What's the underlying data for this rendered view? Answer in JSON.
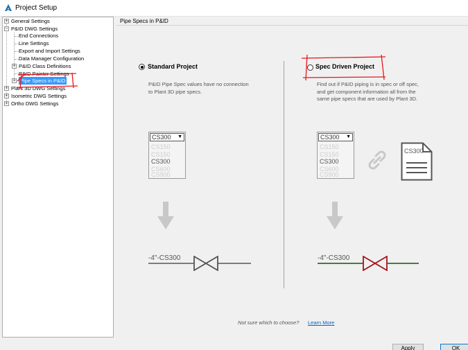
{
  "window": {
    "title": "Project Setup"
  },
  "tree": {
    "items": [
      {
        "label": "General Settings",
        "expander": "+"
      },
      {
        "label": "P&ID DWG Settings",
        "expander": "−"
      },
      {
        "label": "End Connections"
      },
      {
        "label": "Line Settings"
      },
      {
        "label": "Export and Import Settings"
      },
      {
        "label": "Data Manager Configuration"
      },
      {
        "label": "P&ID Class Definitions",
        "expander": "+"
      },
      {
        "label": "P&ID Painter Settings"
      },
      {
        "label": "Pipe Specs in P&ID",
        "expander": "+",
        "selected": true
      },
      {
        "label": "Plant 3D DWG Settings",
        "expander": "+"
      },
      {
        "label": "Isometric DWG Settings",
        "expander": "+"
      },
      {
        "label": "Ortho DWG Settings",
        "expander": "+"
      }
    ]
  },
  "content": {
    "section_title": "Pipe Specs in P&ID",
    "standard": {
      "label": "Standard Project",
      "selected": true,
      "description": [
        "P&ID Pipe Spec values have no connection",
        "to Plant 3D pipe specs."
      ],
      "dropdown_value": "CS300",
      "options": [
        "CS150",
        "CS150",
        "CS300",
        "CS600",
        "CS900"
      ],
      "pipe_label": "-4\"-CS300"
    },
    "spec_driven": {
      "label": "Spec Driven Project",
      "selected": false,
      "description": [
        "Find out if P&ID piping is in spec or off spec,",
        "and get component information all from the",
        "same pipe specs that are used by Plant 3D."
      ],
      "dropdown_value": "CS300",
      "options": [
        "CS150",
        "CS150",
        "CS300",
        "CS600",
        "CS900"
      ],
      "document_label": "CS300",
      "pipe_label": "-4\"-CS300"
    },
    "footer": {
      "question": "Not sure which to choose?",
      "link": "Learn More"
    }
  },
  "buttons": {
    "apply": "Apply",
    "ok": "OK"
  },
  "colors": {
    "selection": "#3399ff",
    "annotation": "#e8151b",
    "standard_valve": "#555555",
    "spec_valve": "#a3141c",
    "spec_pipe": "#2f6b1f"
  }
}
